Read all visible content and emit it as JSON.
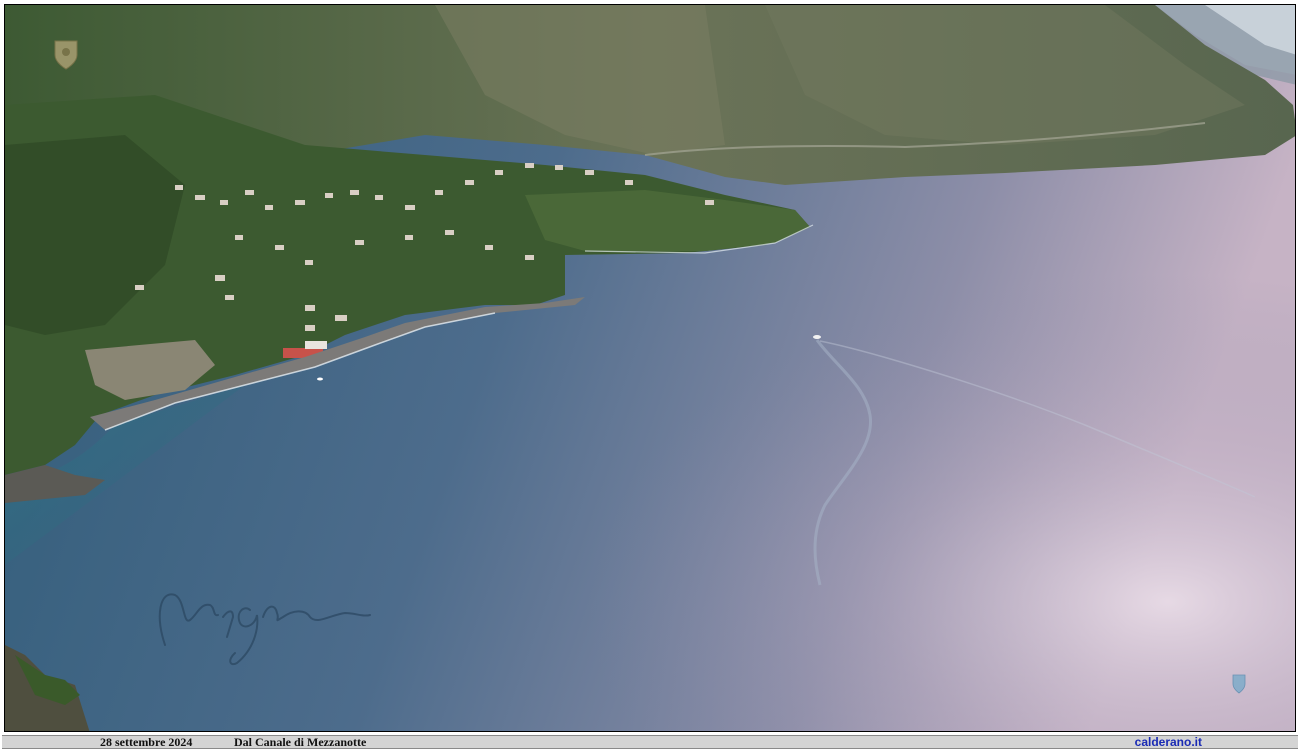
{
  "photo": {
    "subject": "coastal bay aerial view",
    "signature_text": "Mario Calderano",
    "colors": {
      "sea_deep": "#3e5f7f",
      "sea_mid": "#5a7694",
      "sea_glare": "#c7b9cc",
      "mountain_dark": "#37512f",
      "mountain_light": "#6e7a5c",
      "beach": "#7c7a78",
      "sky_haze": "#c9d2da"
    }
  },
  "caption": {
    "date": "28 settembre 2024",
    "place": "Dal Canale di Mezzanotte",
    "site": "calderano.it"
  },
  "icons": {
    "top_left_logo": "shield-crest-icon",
    "bottom_right_logo": "small-crest-icon"
  }
}
